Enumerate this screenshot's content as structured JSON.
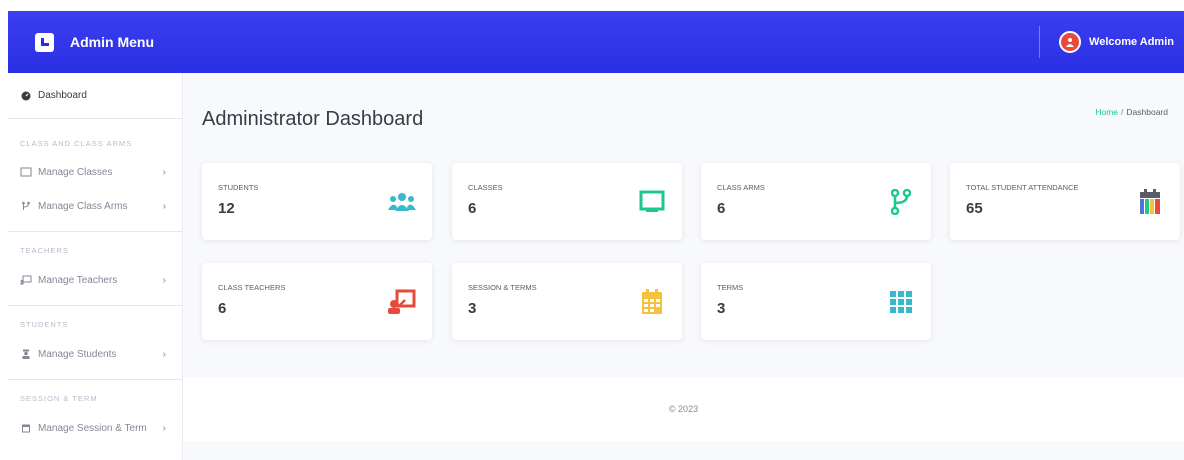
{
  "topbar": {
    "title": "Admin Menu",
    "welcome": "Welcome Admin"
  },
  "sidebar": {
    "dashboard_label": "Dashboard",
    "sections": [
      {
        "heading": "CLASS AND CLASS ARMS",
        "items": [
          {
            "label": "Manage Classes",
            "icon": "chalkboard-icon"
          },
          {
            "label": "Manage Class Arms",
            "icon": "code-branch-icon"
          }
        ]
      },
      {
        "heading": "TEACHERS",
        "items": [
          {
            "label": "Manage Teachers",
            "icon": "teacher-icon"
          }
        ]
      },
      {
        "heading": "STUDENTS",
        "items": [
          {
            "label": "Manage Students",
            "icon": "student-icon"
          }
        ]
      },
      {
        "heading": "SESSION & TERM",
        "items": [
          {
            "label": "Manage Session & Term",
            "icon": "calendar-icon"
          }
        ]
      }
    ]
  },
  "main": {
    "title": "Administrator Dashboard",
    "breadcrumb": {
      "home": "Home",
      "current": "Dashboard"
    },
    "cards": [
      {
        "label": "STUDENTS",
        "value": "12",
        "icon": "users-icon",
        "color": "#36b9cc"
      },
      {
        "label": "CLASSES",
        "value": "6",
        "icon": "chalkboard-icon",
        "color": "#1cc88a"
      },
      {
        "label": "CLASS ARMS",
        "value": "6",
        "icon": "code-branch-icon",
        "color": "#1cc88a"
      },
      {
        "label": "TOTAL STUDENT ATTENDANCE",
        "value": "65",
        "icon": "calendar-check-icon",
        "color": "#5a5c69"
      },
      {
        "label": "CLASS TEACHERS",
        "value": "6",
        "icon": "teacher-icon",
        "color": "#e74a3b"
      },
      {
        "label": "SESSION & TERMS",
        "value": "3",
        "icon": "calendar-icon",
        "color": "#f6c23e"
      },
      {
        "label": "TERMS",
        "value": "3",
        "icon": "grid-icon",
        "color": "#36b9cc"
      }
    ],
    "footer": "© 2023"
  }
}
